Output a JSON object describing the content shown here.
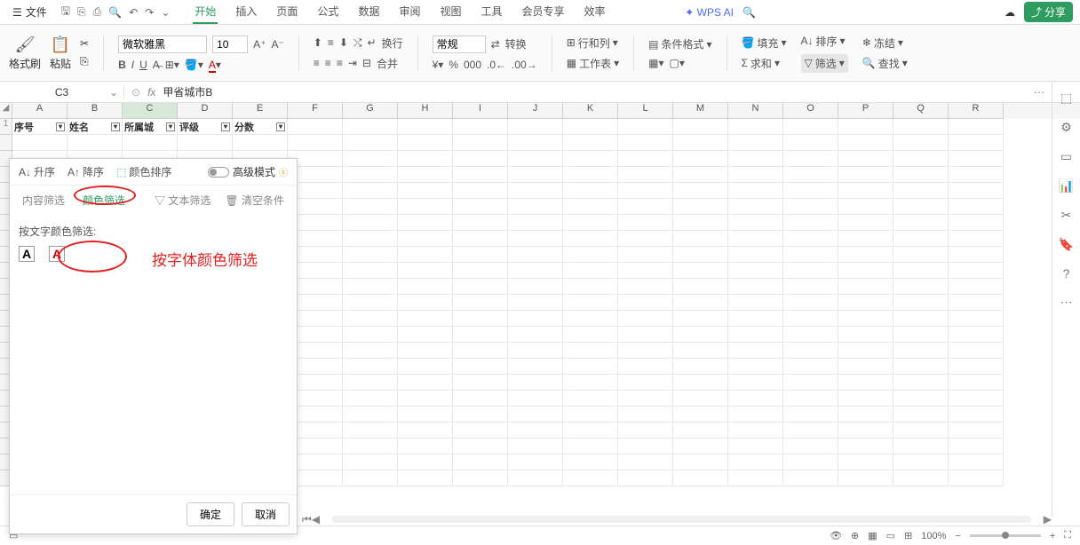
{
  "menubar": {
    "file": "文件",
    "tabs": [
      "开始",
      "插入",
      "页面",
      "公式",
      "数据",
      "审阅",
      "视图",
      "工具",
      "会员专享",
      "效率"
    ],
    "active_tab": "开始",
    "wps_ai": "WPS AI",
    "share": "分享"
  },
  "ribbon": {
    "brush": "格式刷",
    "paste": "粘贴",
    "font_name": "微软雅黑",
    "font_size": "10",
    "general": "常规",
    "convert": "转换",
    "rowcol": "行和列",
    "sheet": "工作表",
    "cond_format": "条件格式",
    "merge": "合并",
    "wrap": "换行",
    "fill": "填充",
    "sort": "排序",
    "sum": "求和",
    "filter": "筛选",
    "freeze": "冻结",
    "find": "查找"
  },
  "formula_bar": {
    "cell_ref": "C3",
    "formula": "甲省城市B"
  },
  "columns": [
    "A",
    "B",
    "C",
    "D",
    "E",
    "F",
    "G",
    "H",
    "I",
    "J",
    "K",
    "L",
    "M",
    "N",
    "O",
    "P",
    "Q",
    "R"
  ],
  "data_headers": [
    "序号",
    "姓名",
    "所属城",
    "评级",
    "分数"
  ],
  "filter_panel": {
    "asc": "升序",
    "desc": "降序",
    "color_sort": "颜色排序",
    "adv_mode": "高级模式",
    "tab_content": "内容筛选",
    "tab_color": "颜色筛选",
    "tab_text": "文本筛选",
    "tab_clear": "清空条件",
    "filter_by_text_color": "按文字颜色筛选:",
    "annotation": "按字体颜色筛选",
    "ok": "确定",
    "cancel": "取消"
  },
  "status": {
    "zoom": "100%"
  }
}
